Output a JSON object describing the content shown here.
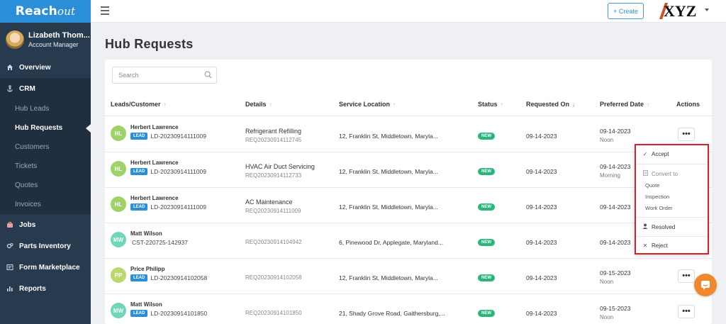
{
  "brand": {
    "name_bold": "Reach",
    "name_script": "out"
  },
  "user": {
    "name": "Lizabeth Thom...",
    "role": "Account Manager"
  },
  "nav": {
    "overview": "Overview",
    "crm": "CRM",
    "crm_items": [
      "Hub Leads",
      "Hub Requests",
      "Customers",
      "Tickets",
      "Quotes",
      "Invoices"
    ],
    "jobs": "Jobs",
    "parts": "Parts Inventory",
    "forms": "Form Marketplace",
    "reports": "Reports"
  },
  "topbar": {
    "create_label": "+ Create",
    "company_logo": "XYZ"
  },
  "page": {
    "title": "Hub Requests"
  },
  "search": {
    "placeholder": "Search"
  },
  "table": {
    "headers": {
      "customer": "Leads/Customer",
      "details": "Details",
      "location": "Service Location",
      "status": "Status",
      "requested": "Requested On",
      "preferred": "Preferred Date",
      "actions": "Actions"
    },
    "rows": [
      {
        "initials": "HL",
        "name": "Herbert Lawrence",
        "badge": "LEAD",
        "id": "LD-20230914111009",
        "detail": "Refrigerant Refilling",
        "req": "REQ20230914112745",
        "location": "12, Franklin St, Middletown, Maryla...",
        "status": "NEW",
        "requested": "09-14-2023",
        "preferred": "09-14-2023",
        "preferred_time": "Noon"
      },
      {
        "initials": "HL",
        "name": "Herbert Lawrence",
        "badge": "LEAD",
        "id": "LD-20230914111009",
        "detail": "HVAC Air Duct Servicing",
        "req": "REQ20230914112733",
        "location": "12, Franklin St, Middletown, Maryla...",
        "status": "NEW",
        "requested": "09-14-2023",
        "preferred": "09-14-2023",
        "preferred_time": "Morning"
      },
      {
        "initials": "HL",
        "name": "Herbert Lawrence",
        "badge": "LEAD",
        "id": "LD-20230914111009",
        "detail": "AC Maintenance",
        "req": "REQ20230914111009",
        "location": "12, Franklin St, Middletown, Maryla...",
        "status": "NEW",
        "requested": "09-14-2023",
        "preferred": "09-14-2023",
        "preferred_time": ""
      },
      {
        "initials": "MW",
        "name": "Matt Wilson",
        "badge": "",
        "id": "CST-220725-142937",
        "detail": "",
        "req": "REQ20230914104942",
        "location": "6, Pinewood Dr, Applegate, Maryland...",
        "status": "NEW",
        "requested": "09-14-2023",
        "preferred": "09-14-2023",
        "preferred_time": ""
      },
      {
        "initials": "PP",
        "name": "Price Philipp",
        "badge": "LEAD",
        "id": "LD-20230914102058",
        "detail": "",
        "req": "REQ20230914102058",
        "location": "12, Franklin St, Middletown, Maryla...",
        "status": "NEW",
        "requested": "09-14-2023",
        "preferred": "09-15-2023",
        "preferred_time": "Noon"
      },
      {
        "initials": "MW",
        "name": "Matt Wilson",
        "badge": "LEAD",
        "id": "LD-20230914101850",
        "detail": "",
        "req": "REQ20230914101850",
        "location": "21, Shady Grove Road, Gaithersburg,...",
        "status": "NEW",
        "requested": "09-14-2023",
        "preferred": "09-15-2023",
        "preferred_time": "Noon"
      }
    ]
  },
  "action_menu": {
    "accept": "Accept",
    "convert_to": "Convert to",
    "quote": "Quote",
    "inspection": "Inspection",
    "work_order": "Work Order",
    "resolved": "Resolved",
    "reject": "Reject"
  },
  "colors": {
    "brand_blue": "#2b8ed8",
    "sidebar": "#283a4e",
    "status_new": "#28b67a",
    "highlight": "#d4202c",
    "chat": "#f0892e",
    "avatar_hl": "#9ed36a",
    "avatar_mw": "#6fd6b9",
    "avatar_pp": "#b9d96a"
  }
}
